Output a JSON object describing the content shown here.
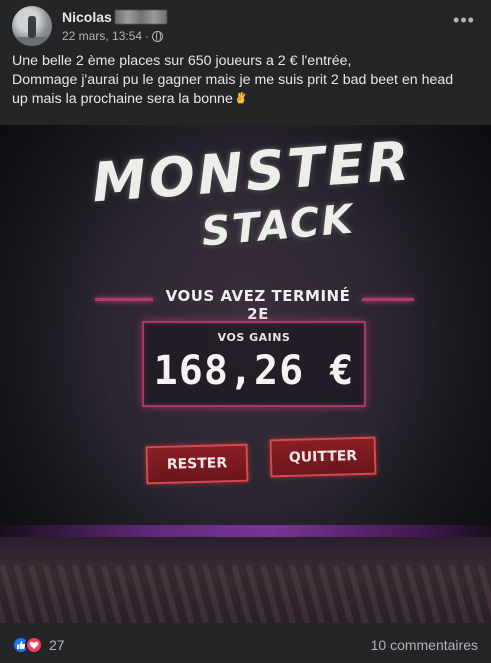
{
  "post": {
    "author": "Nicolas",
    "date": "22 mars, 13:54",
    "separator": "·",
    "more_label": "•••",
    "text_lines": [
      "Une belle 2 ème places sur 650 joueurs a 2 € l'entrée,",
      "Dommage j'aurai pu le gagner mais je me suis prit 2 bad beet en head",
      "up mais la prochaine sera la bonne"
    ],
    "emoji": "ok-hand",
    "icons": {
      "privacy": "globe-icon",
      "more": "more-options-icon"
    }
  },
  "image": {
    "logo_line1": "MONSTER",
    "logo_line2": "STACK",
    "finish_text": "VOUS AVEZ TERMINÉ 2E",
    "gains_label": "VOS GAINS",
    "gains_value": "168,26 €",
    "button_stay": "RESTER",
    "button_quit": "QUITTER",
    "colors": {
      "accent": "#b03a6e",
      "button": "#8a1e24",
      "button_border": "#d8484d",
      "stripe": "#8a38a8"
    }
  },
  "footer": {
    "reaction_count": "27",
    "comments": "10 commentaires",
    "reaction_icons": [
      "like-icon",
      "love-icon"
    ],
    "colors": {
      "like": "#1877f2",
      "love": "#f33e58"
    }
  }
}
